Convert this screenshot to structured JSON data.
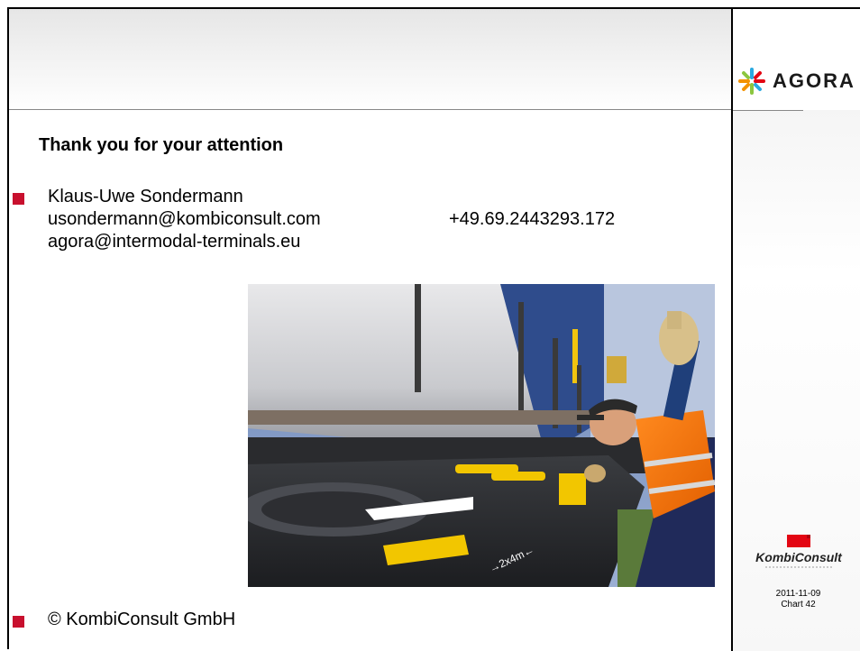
{
  "header": {
    "logo_text": "AGORA"
  },
  "slide": {
    "title": "Thank you for your attention",
    "contact": {
      "name": "Klaus-Uwe Sondermann",
      "email": "usondermann@kombiconsult.com",
      "phone": "+49.69.2443293.172",
      "email2": "agora@intermodal-terminals.eu"
    },
    "footer_bullet": "© KombiConsult GmbH"
  },
  "sidebar": {
    "company_logo_text": "KombiConsult",
    "date": "2011-11-09",
    "chart_label": "Chart 42"
  },
  "colors": {
    "bullet": "#c8102e",
    "logo_blue": "#2aa9e0",
    "logo_green": "#8cc63f",
    "logo_orange": "#f39200",
    "logo_red": "#e30613"
  }
}
